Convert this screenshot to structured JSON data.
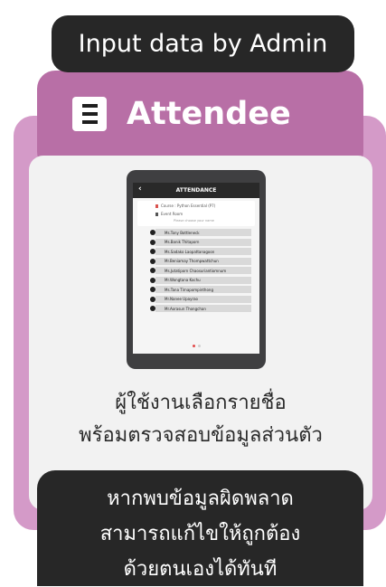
{
  "header": {
    "title": "Input data by Admin"
  },
  "section": {
    "icon": "menu-icon",
    "title": "Attendee"
  },
  "tablet": {
    "screen_title": "ATTENDANCE",
    "course": "Course : Python Essential (P7)",
    "event": "Event Room",
    "choose_hint": "Please choose your name",
    "names": [
      "Ms.Tony Bottleneck",
      "Ms.Banik Thitaporn",
      "Ms.Sadako Laopattanagoon",
      "Mr.Beniamay Thompwattchun",
      "Ms.Jutatiporn Chaosuriantiomnum",
      "Mr.Wongtana Kochu",
      "Ms.Tana Tirnapompinthong",
      "Mr.Nanee Upayrao",
      "Mr.Aorasun Thongchan"
    ]
  },
  "description": {
    "line1": "ผู้ใช้งานเลือกรายชื่อ",
    "line2": "พร้อมตรวจสอบข้อมูลส่วนตัว"
  },
  "note": {
    "line1": "หากพบข้อมูลผิดพลาด",
    "line2": "สามารถแก้ไขให้ถูกต้อง",
    "line3": "ด้วยตนเองได้ทันที"
  },
  "colors": {
    "dark": "#272727",
    "purple_mid": "#b86fa6",
    "purple_light": "#d49ac8",
    "card": "#f2f2f2"
  }
}
